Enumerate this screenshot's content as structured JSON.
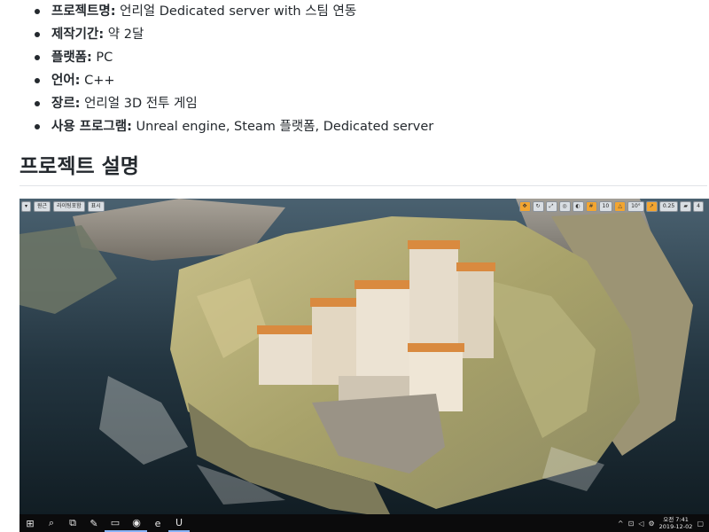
{
  "project_info": [
    {
      "label": "프로젝트명:",
      "value": " 언리얼 Dedicated server with 스팀 연동"
    },
    {
      "label": "제작기간:",
      "value": " 약 2달"
    },
    {
      "label": "플랫폼:",
      "value": " PC"
    },
    {
      "label": "언어:",
      "value": " C++"
    },
    {
      "label": "장르:",
      "value": " 언리얼 3D 전투 게임"
    },
    {
      "label": "사용 프로그램:",
      "value": " Unreal engine, Steam 플랫폼, Dedicated server"
    }
  ],
  "section_heading": "프로젝트 설명",
  "screenshot": {
    "viewport_toolbar_left": [
      "원근",
      "라이팅포함",
      "표시"
    ],
    "viewport_toolbar_right": {
      "grid_snap": "10",
      "rotation_snap": "10°",
      "scale_snap": "0.25",
      "camera_speed": "4"
    },
    "taskbar": {
      "items": [
        "start-icon",
        "search-icon",
        "task-view-icon",
        "paint-icon",
        "file-explorer-icon",
        "chrome-icon",
        "edge-icon",
        "unreal-icon"
      ],
      "clock_time": "오전 7:41",
      "clock_date": "2019-12-02",
      "colors": {
        "taskbar": "#0b0b0c",
        "accent": "#8ab4f8"
      }
    }
  }
}
